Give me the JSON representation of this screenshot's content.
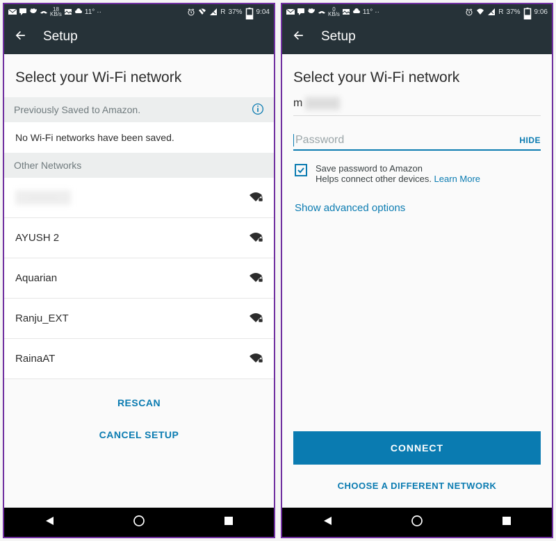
{
  "left": {
    "status": {
      "kb_rate": "18",
      "kb_unit": "KB/s",
      "temp": "11°",
      "network_label": "R",
      "battery_pct": "37%",
      "time": "9:04"
    },
    "header": {
      "title": "Setup"
    },
    "page_title": "Select your Wi-Fi network",
    "saved_section": {
      "header": "Previously Saved to Amazon.",
      "empty_msg": "No Wi-Fi networks have been saved."
    },
    "other_header": "Other Networks",
    "networks": [
      {
        "name": "········"
      },
      {
        "name": "AYUSH 2"
      },
      {
        "name": "Aquarian"
      },
      {
        "name": "Ranju_EXT"
      },
      {
        "name": "RainaAT"
      }
    ],
    "rescan_label": "RESCAN",
    "cancel_label": "CANCEL SETUP"
  },
  "right": {
    "status": {
      "kb_rate": "0",
      "kb_unit": "KB/s",
      "temp": "11°",
      "network_label": "R",
      "battery_pct": "37%",
      "time": "9:06"
    },
    "header": {
      "title": "Setup"
    },
    "page_title": "Select your Wi-Fi network",
    "ssid_prefix": "m",
    "password_placeholder": "Password",
    "hide_label": "HIDE",
    "save_pwd_line1": "Save password to Amazon",
    "save_pwd_line2_a": "Helps connect other devices. ",
    "save_pwd_learn": "Learn More",
    "advanced_label": "Show advanced options",
    "connect_label": "CONNECT",
    "choose_label": "CHOOSE A DIFFERENT NETWORK"
  }
}
